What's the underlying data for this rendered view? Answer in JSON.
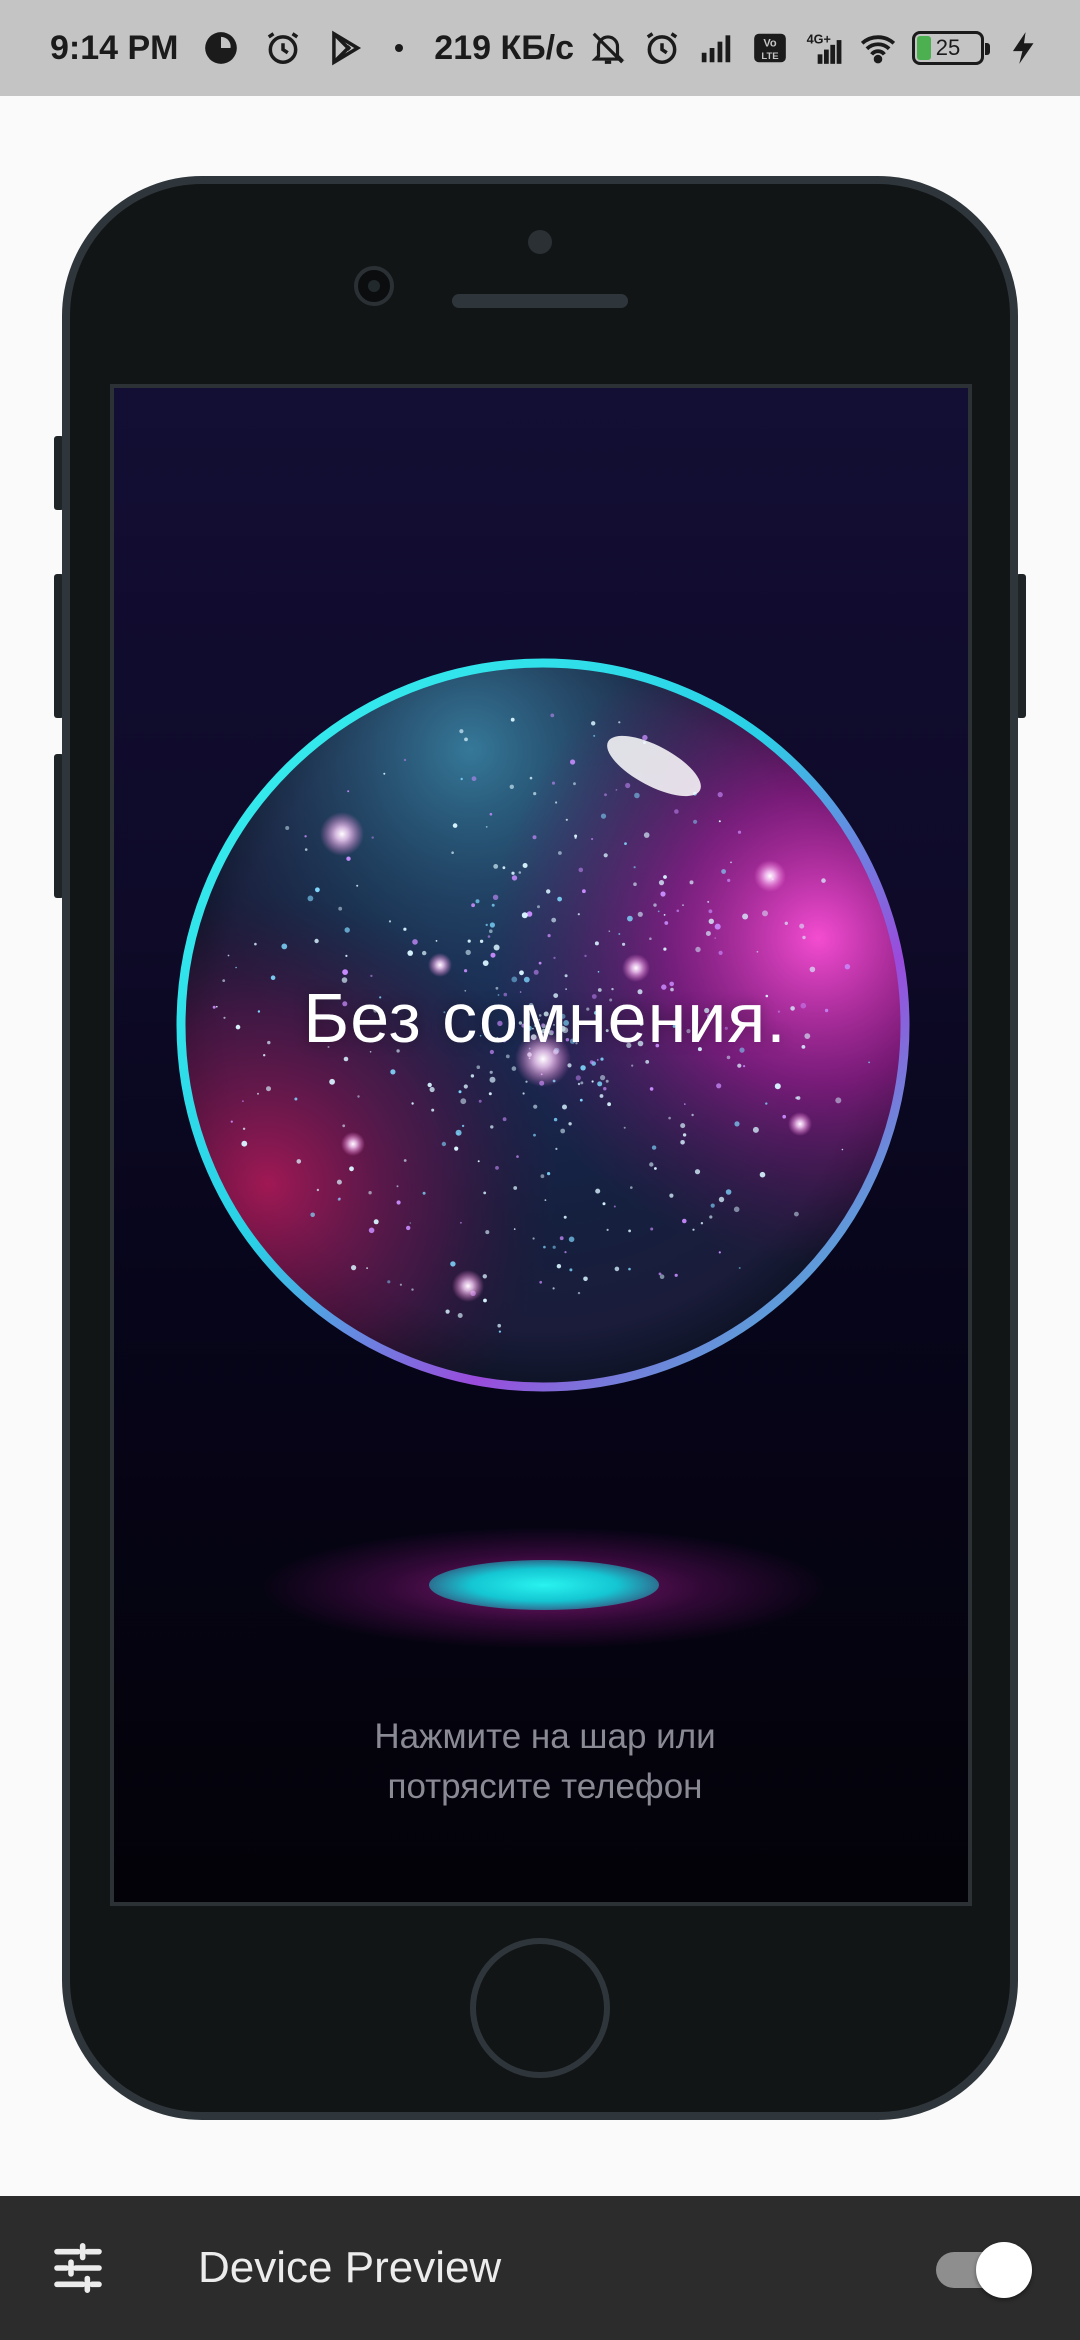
{
  "status_bar": {
    "time": "9:14 PM",
    "network_speed": "219 КБ/с",
    "battery_level": "25",
    "icons_left": [
      "app-notification-icon",
      "alarm-icon",
      "play-store-icon",
      "dot"
    ],
    "icons_right": [
      "bell-off-icon",
      "alarm-icon",
      "signal-icon",
      "volte-icon",
      "4g-signal-icon",
      "wifi-icon",
      "battery-icon",
      "charging-icon"
    ]
  },
  "app": {
    "answer_text": "Без сомнения.",
    "hint_line1": "Нажмите на шар или",
    "hint_line2": "потрясите телефон"
  },
  "toolbar": {
    "title": "Device Preview",
    "toggle_on": true
  },
  "colors": {
    "accent_cyan": "#29f3f0",
    "accent_magenta": "#e028be",
    "toolbar_bg": "#2c2c2c",
    "status_bar_bg": "#c4c4c4"
  }
}
